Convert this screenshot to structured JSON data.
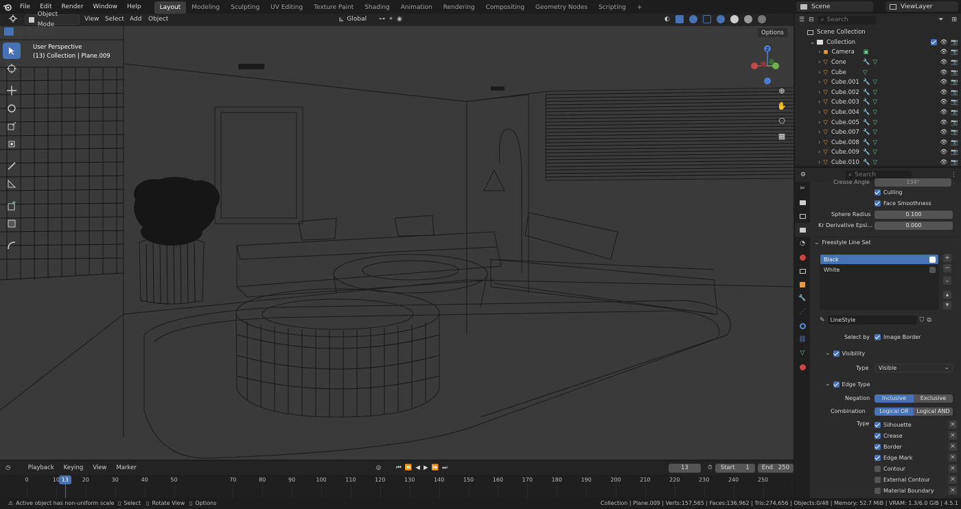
{
  "topbar": {
    "menus": [
      "File",
      "Edit",
      "Render",
      "Window",
      "Help"
    ],
    "workspaces": [
      "Layout",
      "Modeling",
      "Sculpting",
      "UV Editing",
      "Texture Paint",
      "Shading",
      "Animation",
      "Rendering",
      "Compositing",
      "Geometry Nodes",
      "Scripting"
    ],
    "active_workspace": "Layout",
    "add_tab": "+",
    "scene": "Scene",
    "view_layer": "ViewLayer"
  },
  "viewport_header": {
    "mode": "Object Mode",
    "menus": [
      "View",
      "Select",
      "Add",
      "Object"
    ],
    "orientation": "Global",
    "options": "Options"
  },
  "viewport": {
    "perspective": "User Perspective",
    "collection_info": "(13) Collection | Plane.009",
    "gizmo_axes": {
      "z": "Z"
    }
  },
  "outliner": {
    "search_placeholder": "Search",
    "scene_collection": "Scene Collection",
    "collection": "Collection",
    "items": [
      "Camera",
      "Cone",
      "Cube",
      "Cube.001",
      "Cube.002",
      "Cube.003",
      "Cube.004",
      "Cube.005",
      "Cube.007",
      "Cube.008",
      "Cube.009",
      "Cube.010"
    ]
  },
  "properties": {
    "search_placeholder": "Search",
    "partial_label": "Crease Angle",
    "partial_value": "134°",
    "culling": "Culling",
    "face_smoothness": "Face Smoothness",
    "sphere_radius_label": "Sphere Radius",
    "sphere_radius": "0.100",
    "kr_label": "Kr Derivative Epsi...",
    "kr_value": "0.000",
    "lineset_header": "Freestyle Line Set",
    "linesets": [
      "Black",
      "White"
    ],
    "linestyle": "LineStyle",
    "select_by_label": "Select by",
    "image_border": "Image Border",
    "visibility": "Visibility",
    "type_label": "Type",
    "visibility_type": "Visible",
    "edge_type": "Edge Type",
    "negation_label": "Negation",
    "negation": [
      "Inclusive",
      "Exclusive"
    ],
    "combination_label": "Combination",
    "combination": [
      "Logical OR",
      "Logical AND"
    ],
    "edge_types": [
      {
        "label": "Silhouette",
        "checked": true
      },
      {
        "label": "Crease",
        "checked": true
      },
      {
        "label": "Border",
        "checked": true
      },
      {
        "label": "Edge Mark",
        "checked": true
      },
      {
        "label": "Contour",
        "checked": false
      },
      {
        "label": "External Contour",
        "checked": false
      },
      {
        "label": "Material Boundary",
        "checked": false
      }
    ]
  },
  "timeline": {
    "menus": [
      "Playback",
      "Keying",
      "View",
      "Marker"
    ],
    "current_frame": "13",
    "start_label": "Start",
    "start": "1",
    "end_label": "End",
    "end": "250",
    "ticks": [
      "0",
      "10",
      "20",
      "30",
      "40",
      "50",
      "70",
      "80",
      "90",
      "100",
      "110",
      "120",
      "130",
      "140",
      "150",
      "160",
      "170",
      "180",
      "190",
      "200",
      "210",
      "220",
      "230",
      "240",
      "250"
    ]
  },
  "statusbar": {
    "warning": "Active object has non-uniform scale",
    "select": "Select",
    "rotate": "Rotate View",
    "options": "Options",
    "stats": "Collection | Plane.009 | Verts:157,565 | Faces:136,962 | Tris:274,656 | Objects:0/48 | Memory: 52.7 MiB | VRAM: 1.3/6.0 GiB | 4.5.1"
  },
  "colors": {
    "accent": "#4772b3",
    "orange": "#e89a3c",
    "green": "#6fcf97"
  }
}
